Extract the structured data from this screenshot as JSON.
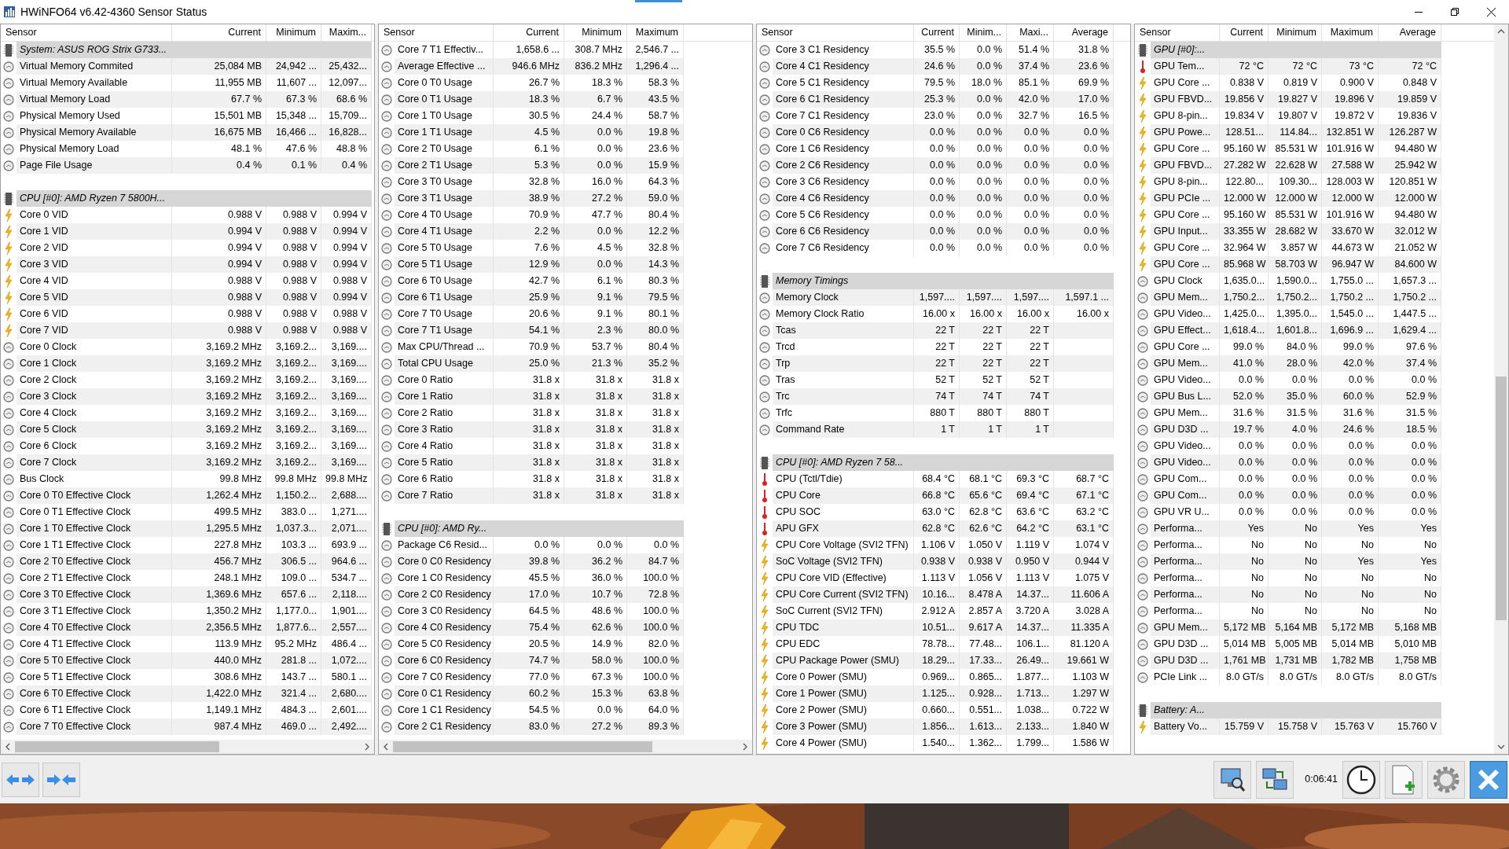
{
  "window": {
    "title": "HWiNFO64 v6.42-4360 Sensor Status"
  },
  "panels": [
    {
      "columns": [
        "Sensor",
        "Current",
        "Minimum",
        "Maxim..."
      ],
      "rows": [
        {
          "kind": "group",
          "label": "System: ASUS ROG Strix G733..."
        },
        {
          "kind": "clock",
          "label": "Virtual Memory Commited",
          "values": [
            "25,084 MB",
            "24,942 ...",
            "25,432..."
          ]
        },
        {
          "kind": "clock",
          "label": "Virtual Memory Available",
          "values": [
            "11,955 MB",
            "11,607 ...",
            "12,097..."
          ]
        },
        {
          "kind": "clock",
          "label": "Virtual Memory Load",
          "values": [
            "67.7 %",
            "67.3 %",
            "68.6 %"
          ]
        },
        {
          "kind": "clock",
          "label": "Physical Memory Used",
          "values": [
            "15,501 MB",
            "15,348 ...",
            "15,709..."
          ]
        },
        {
          "kind": "clock",
          "label": "Physical Memory Available",
          "values": [
            "16,675 MB",
            "16,466 ...",
            "16,828..."
          ]
        },
        {
          "kind": "clock",
          "label": "Physical Memory Load",
          "values": [
            "48.1 %",
            "47.6 %",
            "48.8 %"
          ]
        },
        {
          "kind": "clock",
          "label": "Page File Usage",
          "values": [
            "0.4 %",
            "0.1 %",
            "0.4 %"
          ]
        },
        {
          "kind": "blank"
        },
        {
          "kind": "group",
          "label": "CPU [#0]: AMD Ryzen 7 5800H..."
        },
        {
          "kind": "bolt",
          "label": "Core 0 VID",
          "values": [
            "0.988 V",
            "0.988 V",
            "0.994 V"
          ]
        },
        {
          "kind": "bolt",
          "label": "Core 1 VID",
          "values": [
            "0.994 V",
            "0.988 V",
            "0.994 V"
          ]
        },
        {
          "kind": "bolt",
          "label": "Core 2 VID",
          "values": [
            "0.994 V",
            "0.988 V",
            "0.994 V"
          ]
        },
        {
          "kind": "bolt",
          "label": "Core 3 VID",
          "values": [
            "0.994 V",
            "0.988 V",
            "0.994 V"
          ]
        },
        {
          "kind": "bolt",
          "label": "Core 4 VID",
          "values": [
            "0.988 V",
            "0.988 V",
            "0.988 V"
          ]
        },
        {
          "kind": "bolt",
          "label": "Core 5 VID",
          "values": [
            "0.988 V",
            "0.988 V",
            "0.994 V"
          ]
        },
        {
          "kind": "bolt",
          "label": "Core 6 VID",
          "values": [
            "0.988 V",
            "0.988 V",
            "0.988 V"
          ]
        },
        {
          "kind": "bolt",
          "label": "Core 7 VID",
          "values": [
            "0.988 V",
            "0.988 V",
            "0.988 V"
          ]
        },
        {
          "kind": "clock",
          "label": "Core 0 Clock",
          "values": [
            "3,169.2 MHz",
            "3,169.2...",
            "3,169...."
          ]
        },
        {
          "kind": "clock",
          "label": "Core 1 Clock",
          "values": [
            "3,169.2 MHz",
            "3,169.2...",
            "3,169...."
          ]
        },
        {
          "kind": "clock",
          "label": "Core 2 Clock",
          "values": [
            "3,169.2 MHz",
            "3,169.2...",
            "3,169...."
          ]
        },
        {
          "kind": "clock",
          "label": "Core 3 Clock",
          "values": [
            "3,169.2 MHz",
            "3,169.2...",
            "3,169...."
          ]
        },
        {
          "kind": "clock",
          "label": "Core 4 Clock",
          "values": [
            "3,169.2 MHz",
            "3,169.2...",
            "3,169...."
          ]
        },
        {
          "kind": "clock",
          "label": "Core 5 Clock",
          "values": [
            "3,169.2 MHz",
            "3,169.2...",
            "3,169...."
          ]
        },
        {
          "kind": "clock",
          "label": "Core 6 Clock",
          "values": [
            "3,169.2 MHz",
            "3,169.2...",
            "3,169...."
          ]
        },
        {
          "kind": "clock",
          "label": "Core 7 Clock",
          "values": [
            "3,169.2 MHz",
            "3,169.2...",
            "3,169...."
          ]
        },
        {
          "kind": "clock",
          "label": "Bus Clock",
          "values": [
            "99.8 MHz",
            "99.8 MHz",
            "99.8 MHz"
          ]
        },
        {
          "kind": "clock",
          "label": "Core 0 T0 Effective Clock",
          "values": [
            "1,262.4 MHz",
            "1,150.2...",
            "2,688...."
          ]
        },
        {
          "kind": "clock",
          "label": "Core 0 T1 Effective Clock",
          "values": [
            "499.5 MHz",
            "383.0 ...",
            "1,271...."
          ]
        },
        {
          "kind": "clock",
          "label": "Core 1 T0 Effective Clock",
          "values": [
            "1,295.5 MHz",
            "1,037.3...",
            "2,071...."
          ]
        },
        {
          "kind": "clock",
          "label": "Core 1 T1 Effective Clock",
          "values": [
            "227.8 MHz",
            "103.3 ...",
            "693.9 ..."
          ]
        },
        {
          "kind": "clock",
          "label": "Core 2 T0 Effective Clock",
          "values": [
            "456.7 MHz",
            "306.5 ...",
            "964.6 ..."
          ]
        },
        {
          "kind": "clock",
          "label": "Core 2 T1 Effective Clock",
          "values": [
            "248.1 MHz",
            "109.0 ...",
            "534.7 ..."
          ]
        },
        {
          "kind": "clock",
          "label": "Core 3 T0 Effective Clock",
          "values": [
            "1,369.6 MHz",
            "657.6 ...",
            "2,118...."
          ]
        },
        {
          "kind": "clock",
          "label": "Core 3 T1 Effective Clock",
          "values": [
            "1,350.2 MHz",
            "1,177.0...",
            "1,901...."
          ]
        },
        {
          "kind": "clock",
          "label": "Core 4 T0 Effective Clock",
          "values": [
            "2,356.5 MHz",
            "1,877.6...",
            "2,557...."
          ]
        },
        {
          "kind": "clock",
          "label": "Core 4 T1 Effective Clock",
          "values": [
            "113.9 MHz",
            "95.2 MHz",
            "486.4 ..."
          ]
        },
        {
          "kind": "clock",
          "label": "Core 5 T0 Effective Clock",
          "values": [
            "440.0 MHz",
            "281.8 ...",
            "1,072...."
          ]
        },
        {
          "kind": "clock",
          "label": "Core 5 T1 Effective Clock",
          "values": [
            "308.6 MHz",
            "143.7 ...",
            "580.1 ..."
          ]
        },
        {
          "kind": "clock",
          "label": "Core 6 T0 Effective Clock",
          "values": [
            "1,422.0 MHz",
            "321.4 ...",
            "2,680...."
          ]
        },
        {
          "kind": "clock",
          "label": "Core 6 T1 Effective Clock",
          "values": [
            "1,149.1 MHz",
            "484.3 ...",
            "2,601...."
          ]
        },
        {
          "kind": "clock",
          "label": "Core 7 T0 Effective Clock",
          "values": [
            "987.4 MHz",
            "469.0 ...",
            "2,492...."
          ]
        }
      ]
    },
    {
      "columns": [
        "Sensor",
        "Current",
        "Minimum",
        "Maximum"
      ],
      "rows": [
        {
          "kind": "clock",
          "label": "Core 7 T1 Effectiv...",
          "values": [
            "1,658.6 ...",
            "308.7 MHz",
            "2,546.7 ..."
          ]
        },
        {
          "kind": "clock",
          "label": "Average Effective ...",
          "values": [
            "946.6 MHz",
            "836.2 MHz",
            "1,296.4 ..."
          ]
        },
        {
          "kind": "clock",
          "label": "Core 0 T0 Usage",
          "values": [
            "26.7 %",
            "18.3 %",
            "58.3 %"
          ]
        },
        {
          "kind": "clock",
          "label": "Core 0 T1 Usage",
          "values": [
            "18.3 %",
            "6.7 %",
            "43.5 %"
          ]
        },
        {
          "kind": "clock",
          "label": "Core 1 T0 Usage",
          "values": [
            "30.5 %",
            "24.4 %",
            "58.7 %"
          ]
        },
        {
          "kind": "clock",
          "label": "Core 1 T1 Usage",
          "values": [
            "4.5 %",
            "0.0 %",
            "19.8 %"
          ]
        },
        {
          "kind": "clock",
          "label": "Core 2 T0 Usage",
          "values": [
            "6.1 %",
            "0.0 %",
            "23.6 %"
          ]
        },
        {
          "kind": "clock",
          "label": "Core 2 T1 Usage",
          "values": [
            "5.3 %",
            "0.0 %",
            "15.9 %"
          ]
        },
        {
          "kind": "clock",
          "label": "Core 3 T0 Usage",
          "values": [
            "32.8 %",
            "16.0 %",
            "64.3 %"
          ]
        },
        {
          "kind": "clock",
          "label": "Core 3 T1 Usage",
          "values": [
            "38.9 %",
            "27.2 %",
            "59.0 %"
          ]
        },
        {
          "kind": "clock",
          "label": "Core 4 T0 Usage",
          "values": [
            "70.9 %",
            "47.7 %",
            "80.4 %"
          ]
        },
        {
          "kind": "clock",
          "label": "Core 4 T1 Usage",
          "values": [
            "2.2 %",
            "0.0 %",
            "12.2 %"
          ]
        },
        {
          "kind": "clock",
          "label": "Core 5 T0 Usage",
          "values": [
            "7.6 %",
            "4.5 %",
            "32.8 %"
          ]
        },
        {
          "kind": "clock",
          "label": "Core 5 T1 Usage",
          "values": [
            "12.9 %",
            "0.0 %",
            "14.3 %"
          ]
        },
        {
          "kind": "clock",
          "label": "Core 6 T0 Usage",
          "values": [
            "42.7 %",
            "6.1 %",
            "80.3 %"
          ]
        },
        {
          "kind": "clock",
          "label": "Core 6 T1 Usage",
          "values": [
            "25.9 %",
            "9.1 %",
            "79.5 %"
          ]
        },
        {
          "kind": "clock",
          "label": "Core 7 T0 Usage",
          "values": [
            "20.6 %",
            "9.1 %",
            "80.1 %"
          ]
        },
        {
          "kind": "clock",
          "label": "Core 7 T1 Usage",
          "values": [
            "54.1 %",
            "2.3 %",
            "80.0 %"
          ]
        },
        {
          "kind": "clock",
          "label": "Max CPU/Thread ...",
          "values": [
            "70.9 %",
            "53.7 %",
            "80.4 %"
          ]
        },
        {
          "kind": "clock",
          "label": "Total CPU Usage",
          "values": [
            "25.0 %",
            "21.3 %",
            "35.2 %"
          ]
        },
        {
          "kind": "clock",
          "label": "Core 0 Ratio",
          "values": [
            "31.8 x",
            "31.8 x",
            "31.8 x"
          ]
        },
        {
          "kind": "clock",
          "label": "Core 1 Ratio",
          "values": [
            "31.8 x",
            "31.8 x",
            "31.8 x"
          ]
        },
        {
          "kind": "clock",
          "label": "Core 2 Ratio",
          "values": [
            "31.8 x",
            "31.8 x",
            "31.8 x"
          ]
        },
        {
          "kind": "clock",
          "label": "Core 3 Ratio",
          "values": [
            "31.8 x",
            "31.8 x",
            "31.8 x"
          ]
        },
        {
          "kind": "clock",
          "label": "Core 4 Ratio",
          "values": [
            "31.8 x",
            "31.8 x",
            "31.8 x"
          ]
        },
        {
          "kind": "clock",
          "label": "Core 5 Ratio",
          "values": [
            "31.8 x",
            "31.8 x",
            "31.8 x"
          ]
        },
        {
          "kind": "clock",
          "label": "Core 6 Ratio",
          "values": [
            "31.8 x",
            "31.8 x",
            "31.8 x"
          ]
        },
        {
          "kind": "clock",
          "label": "Core 7 Ratio",
          "values": [
            "31.8 x",
            "31.8 x",
            "31.8 x"
          ]
        },
        {
          "kind": "blank"
        },
        {
          "kind": "group",
          "label": "CPU [#0]: AMD Ry..."
        },
        {
          "kind": "clock",
          "label": "Package C6 Resid...",
          "values": [
            "0.0 %",
            "0.0 %",
            "0.0 %"
          ]
        },
        {
          "kind": "clock",
          "label": "Core 0 C0 Residency",
          "values": [
            "39.8 %",
            "36.2 %",
            "84.7 %"
          ]
        },
        {
          "kind": "clock",
          "label": "Core 1 C0 Residency",
          "values": [
            "45.5 %",
            "36.0 %",
            "100.0 %"
          ]
        },
        {
          "kind": "clock",
          "label": "Core 2 C0 Residency",
          "values": [
            "17.0 %",
            "10.7 %",
            "72.8 %"
          ]
        },
        {
          "kind": "clock",
          "label": "Core 3 C0 Residency",
          "values": [
            "64.5 %",
            "48.6 %",
            "100.0 %"
          ]
        },
        {
          "kind": "clock",
          "label": "Core 4 C0 Residency",
          "values": [
            "75.4 %",
            "62.6 %",
            "100.0 %"
          ]
        },
        {
          "kind": "clock",
          "label": "Core 5 C0 Residency",
          "values": [
            "20.5 %",
            "14.9 %",
            "82.0 %"
          ]
        },
        {
          "kind": "clock",
          "label": "Core 6 C0 Residency",
          "values": [
            "74.7 %",
            "58.0 %",
            "100.0 %"
          ]
        },
        {
          "kind": "clock",
          "label": "Core 7 C0 Residency",
          "values": [
            "77.0 %",
            "67.3 %",
            "100.0 %"
          ]
        },
        {
          "kind": "clock",
          "label": "Core 0 C1 Residency",
          "values": [
            "60.2 %",
            "15.3 %",
            "63.8 %"
          ]
        },
        {
          "kind": "clock",
          "label": "Core 1 C1 Residency",
          "values": [
            "54.5 %",
            "0.0 %",
            "64.0 %"
          ]
        },
        {
          "kind": "clock",
          "label": "Core 2 C1 Residency",
          "values": [
            "83.0 %",
            "27.2 %",
            "89.3 %"
          ]
        }
      ]
    },
    {
      "columns": [
        "Sensor",
        "Current",
        "Minim...",
        "Maxi...",
        "Average"
      ],
      "rows": [
        {
          "kind": "clock",
          "label": "Core 3 C1 Residency",
          "values": [
            "35.5 %",
            "0.0 %",
            "51.4 %",
            "31.8 %"
          ]
        },
        {
          "kind": "clock",
          "label": "Core 4 C1 Residency",
          "values": [
            "24.6 %",
            "0.0 %",
            "37.4 %",
            "23.6 %"
          ]
        },
        {
          "kind": "clock",
          "label": "Core 5 C1 Residency",
          "values": [
            "79.5 %",
            "18.0 %",
            "85.1 %",
            "69.9 %"
          ]
        },
        {
          "kind": "clock",
          "label": "Core 6 C1 Residency",
          "values": [
            "25.3 %",
            "0.0 %",
            "42.0 %",
            "17.0 %"
          ]
        },
        {
          "kind": "clock",
          "label": "Core 7 C1 Residency",
          "values": [
            "23.0 %",
            "0.0 %",
            "32.7 %",
            "16.5 %"
          ]
        },
        {
          "kind": "clock",
          "label": "Core 0 C6 Residency",
          "values": [
            "0.0 %",
            "0.0 %",
            "0.0 %",
            "0.0 %"
          ]
        },
        {
          "kind": "clock",
          "label": "Core 1 C6 Residency",
          "values": [
            "0.0 %",
            "0.0 %",
            "0.0 %",
            "0.0 %"
          ]
        },
        {
          "kind": "clock",
          "label": "Core 2 C6 Residency",
          "values": [
            "0.0 %",
            "0.0 %",
            "0.0 %",
            "0.0 %"
          ]
        },
        {
          "kind": "clock",
          "label": "Core 3 C6 Residency",
          "values": [
            "0.0 %",
            "0.0 %",
            "0.0 %",
            "0.0 %"
          ]
        },
        {
          "kind": "clock",
          "label": "Core 4 C6 Residency",
          "values": [
            "0.0 %",
            "0.0 %",
            "0.0 %",
            "0.0 %"
          ]
        },
        {
          "kind": "clock",
          "label": "Core 5 C6 Residency",
          "values": [
            "0.0 %",
            "0.0 %",
            "0.0 %",
            "0.0 %"
          ]
        },
        {
          "kind": "clock",
          "label": "Core 6 C6 Residency",
          "values": [
            "0.0 %",
            "0.0 %",
            "0.0 %",
            "0.0 %"
          ]
        },
        {
          "kind": "clock",
          "label": "Core 7 C6 Residency",
          "values": [
            "0.0 %",
            "0.0 %",
            "0.0 %",
            "0.0 %"
          ]
        },
        {
          "kind": "blank"
        },
        {
          "kind": "group",
          "label": "Memory Timings"
        },
        {
          "kind": "clock",
          "label": "Memory Clock",
          "values": [
            "1,597....",
            "1,597....",
            "1,597....",
            "1,597.1 ..."
          ]
        },
        {
          "kind": "clock",
          "label": "Memory Clock Ratio",
          "values": [
            "16.00 x",
            "16.00 x",
            "16.00 x",
            "16.00 x"
          ]
        },
        {
          "kind": "clock",
          "label": "Tcas",
          "values": [
            "22 T",
            "22 T",
            "22 T"
          ]
        },
        {
          "kind": "clock",
          "label": "Trcd",
          "values": [
            "22 T",
            "22 T",
            "22 T"
          ]
        },
        {
          "kind": "clock",
          "label": "Trp",
          "values": [
            "22 T",
            "22 T",
            "22 T"
          ]
        },
        {
          "kind": "clock",
          "label": "Tras",
          "values": [
            "52 T",
            "52 T",
            "52 T"
          ]
        },
        {
          "kind": "clock",
          "label": "Trc",
          "values": [
            "74 T",
            "74 T",
            "74 T"
          ]
        },
        {
          "kind": "clock",
          "label": "Trfc",
          "values": [
            "880 T",
            "880 T",
            "880 T"
          ]
        },
        {
          "kind": "clock",
          "label": "Command Rate",
          "values": [
            "1 T",
            "1 T",
            "1 T"
          ]
        },
        {
          "kind": "blank"
        },
        {
          "kind": "group",
          "label": "CPU [#0]: AMD Ryzen 7 58..."
        },
        {
          "kind": "thermo",
          "label": "CPU (Tctl/Tdie)",
          "values": [
            "68.4 °C",
            "68.1 °C",
            "69.3 °C",
            "68.7 °C"
          ]
        },
        {
          "kind": "thermo",
          "label": "CPU Core",
          "values": [
            "66.8 °C",
            "65.6 °C",
            "69.4 °C",
            "67.1 °C"
          ]
        },
        {
          "kind": "thermo",
          "label": "CPU SOC",
          "values": [
            "63.0 °C",
            "62.8 °C",
            "63.6 °C",
            "63.2 °C"
          ]
        },
        {
          "kind": "thermo",
          "label": "APU GFX",
          "values": [
            "62.8 °C",
            "62.6 °C",
            "64.2 °C",
            "63.1 °C"
          ]
        },
        {
          "kind": "bolt",
          "label": "CPU Core Voltage (SVI2 TFN)",
          "values": [
            "1.106 V",
            "1.050 V",
            "1.119 V",
            "1.074 V"
          ]
        },
        {
          "kind": "bolt",
          "label": "SoC Voltage (SVI2 TFN)",
          "values": [
            "0.938 V",
            "0.938 V",
            "0.950 V",
            "0.944 V"
          ]
        },
        {
          "kind": "bolt",
          "label": "CPU Core VID (Effective)",
          "values": [
            "1.113 V",
            "1.056 V",
            "1.113 V",
            "1.075 V"
          ]
        },
        {
          "kind": "bolt",
          "label": "CPU Core Current (SVI2 TFN)",
          "values": [
            "10.16...",
            "8.478 A",
            "14.37...",
            "11.606 A"
          ]
        },
        {
          "kind": "bolt",
          "label": "SoC Current (SVI2 TFN)",
          "values": [
            "2.912 A",
            "2.857 A",
            "3.720 A",
            "3.028 A"
          ]
        },
        {
          "kind": "bolt",
          "label": "CPU TDC",
          "values": [
            "10.51...",
            "9.617 A",
            "14.37...",
            "11.335 A"
          ]
        },
        {
          "kind": "bolt",
          "label": "CPU EDC",
          "values": [
            "78.78...",
            "77.48...",
            "106.1...",
            "81.120 A"
          ]
        },
        {
          "kind": "bolt",
          "label": "CPU Package Power (SMU)",
          "values": [
            "18.29...",
            "17.33...",
            "26.49...",
            "19.661 W"
          ]
        },
        {
          "kind": "bolt",
          "label": "Core 0 Power (SMU)",
          "values": [
            "0.969...",
            "0.865...",
            "1.877...",
            "1.103 W"
          ]
        },
        {
          "kind": "bolt",
          "label": "Core 1 Power (SMU)",
          "values": [
            "1.125...",
            "0.928...",
            "1.713...",
            "1.297 W"
          ]
        },
        {
          "kind": "bolt",
          "label": "Core 2 Power (SMU)",
          "values": [
            "0.660...",
            "0.551...",
            "1.038...",
            "0.722 W"
          ]
        },
        {
          "kind": "bolt",
          "label": "Core 3 Power (SMU)",
          "values": [
            "1.856...",
            "1.613...",
            "2.133...",
            "1.840 W"
          ]
        },
        {
          "kind": "bolt",
          "label": "Core 4 Power (SMU)",
          "values": [
            "1.540...",
            "1.362...",
            "1.799...",
            "1.586 W"
          ]
        }
      ]
    },
    {
      "columns": [
        "Sensor",
        "Current",
        "Minimum",
        "Maximum",
        "Average"
      ],
      "rows": [
        {
          "kind": "group",
          "label": "GPU [#0]:..."
        },
        {
          "kind": "thermo",
          "label": "GPU Tem...",
          "values": [
            "72 °C",
            "72 °C",
            "73 °C",
            "72 °C"
          ]
        },
        {
          "kind": "bolt",
          "label": "GPU Core ...",
          "values": [
            "0.838 V",
            "0.819 V",
            "0.900 V",
            "0.848 V"
          ]
        },
        {
          "kind": "bolt",
          "label": "GPU FBVD...",
          "values": [
            "19.856 V",
            "19.827 V",
            "19.896 V",
            "19.859 V"
          ]
        },
        {
          "kind": "bolt",
          "label": "GPU 8-pin...",
          "values": [
            "19.834 V",
            "19.807 V",
            "19.872 V",
            "19.836 V"
          ]
        },
        {
          "kind": "bolt",
          "label": "GPU Powe...",
          "values": [
            "128.51...",
            "114.84...",
            "132.851 W",
            "126.287 W"
          ]
        },
        {
          "kind": "bolt",
          "label": "GPU Core ...",
          "values": [
            "95.160 W",
            "85.531 W",
            "101.916 W",
            "94.480 W"
          ]
        },
        {
          "kind": "bolt",
          "label": "GPU FBVD...",
          "values": [
            "27.282 W",
            "22.628 W",
            "27.588 W",
            "25.942 W"
          ]
        },
        {
          "kind": "bolt",
          "label": "GPU 8-pin...",
          "values": [
            "122.80...",
            "109.30...",
            "128.003 W",
            "120.851 W"
          ]
        },
        {
          "kind": "bolt",
          "label": "GPU PCIe ...",
          "values": [
            "12.000 W",
            "12.000 W",
            "12.000 W",
            "12.000 W"
          ]
        },
        {
          "kind": "bolt",
          "label": "GPU Core ...",
          "values": [
            "95.160 W",
            "85.531 W",
            "101.916 W",
            "94.480 W"
          ]
        },
        {
          "kind": "bolt",
          "label": "GPU Input...",
          "values": [
            "33.355 W",
            "28.682 W",
            "33.670 W",
            "32.012 W"
          ]
        },
        {
          "kind": "bolt",
          "label": "GPU Core ...",
          "values": [
            "32.964 W",
            "3.857 W",
            "44.673 W",
            "21.052 W"
          ]
        },
        {
          "kind": "bolt",
          "label": "GPU Core ...",
          "values": [
            "85.968 W",
            "58.703 W",
            "96.947 W",
            "84.600 W"
          ]
        },
        {
          "kind": "clock",
          "label": "GPU Clock",
          "values": [
            "1,635.0...",
            "1,590.0...",
            "1,755.0 ...",
            "1,657.3 ..."
          ]
        },
        {
          "kind": "clock",
          "label": "GPU Mem...",
          "values": [
            "1,750.2...",
            "1,750.2...",
            "1,750.2 ...",
            "1,750.2 ..."
          ]
        },
        {
          "kind": "clock",
          "label": "GPU Video...",
          "values": [
            "1,425.0...",
            "1,395.0...",
            "1,545.0 ...",
            "1,447.5 ..."
          ]
        },
        {
          "kind": "clock",
          "label": "GPU Effect...",
          "values": [
            "1,618.4...",
            "1,601.8...",
            "1,696.9 ...",
            "1,629.4 ..."
          ]
        },
        {
          "kind": "clock",
          "label": "GPU Core ...",
          "values": [
            "99.0 %",
            "84.0 %",
            "99.0 %",
            "97.6 %"
          ]
        },
        {
          "kind": "clock",
          "label": "GPU Mem...",
          "values": [
            "41.0 %",
            "28.0 %",
            "42.0 %",
            "37.4 %"
          ]
        },
        {
          "kind": "clock",
          "label": "GPU Video...",
          "values": [
            "0.0 %",
            "0.0 %",
            "0.0 %",
            "0.0 %"
          ]
        },
        {
          "kind": "clock",
          "label": "GPU Bus L...",
          "values": [
            "52.0 %",
            "35.0 %",
            "60.0 %",
            "52.9 %"
          ]
        },
        {
          "kind": "clock",
          "label": "GPU Mem...",
          "values": [
            "31.6 %",
            "31.5 %",
            "31.6 %",
            "31.5 %"
          ]
        },
        {
          "kind": "clock",
          "label": "GPU D3D ...",
          "values": [
            "19.7 %",
            "4.0 %",
            "24.6 %",
            "18.5 %"
          ]
        },
        {
          "kind": "clock",
          "label": "GPU Video...",
          "values": [
            "0.0 %",
            "0.0 %",
            "0.0 %",
            "0.0 %"
          ]
        },
        {
          "kind": "clock",
          "label": "GPU Video...",
          "values": [
            "0.0 %",
            "0.0 %",
            "0.0 %",
            "0.0 %"
          ]
        },
        {
          "kind": "clock",
          "label": "GPU Com...",
          "values": [
            "0.0 %",
            "0.0 %",
            "0.0 %",
            "0.0 %"
          ]
        },
        {
          "kind": "clock",
          "label": "GPU Com...",
          "values": [
            "0.0 %",
            "0.0 %",
            "0.0 %",
            "0.0 %"
          ]
        },
        {
          "kind": "clock",
          "label": "GPU VR U...",
          "values": [
            "0.0 %",
            "0.0 %",
            "0.0 %",
            "0.0 %"
          ]
        },
        {
          "kind": "clock",
          "label": "Performa...",
          "values": [
            "Yes",
            "No",
            "Yes",
            "Yes"
          ]
        },
        {
          "kind": "clock",
          "label": "Performa...",
          "values": [
            "No",
            "No",
            "No",
            "No"
          ]
        },
        {
          "kind": "clock",
          "label": "Performa...",
          "values": [
            "No",
            "No",
            "Yes",
            "Yes"
          ]
        },
        {
          "kind": "clock",
          "label": "Performa...",
          "values": [
            "No",
            "No",
            "No",
            "No"
          ]
        },
        {
          "kind": "clock",
          "label": "Performa...",
          "values": [
            "No",
            "No",
            "No",
            "No"
          ]
        },
        {
          "kind": "clock",
          "label": "Performa...",
          "values": [
            "No",
            "No",
            "No",
            "No"
          ]
        },
        {
          "kind": "clock",
          "label": "GPU Mem...",
          "values": [
            "5,172 MB",
            "5,164 MB",
            "5,172 MB",
            "5,168 MB"
          ]
        },
        {
          "kind": "clock",
          "label": "GPU D3D ...",
          "values": [
            "5,014 MB",
            "5,005 MB",
            "5,014 MB",
            "5,010 MB"
          ]
        },
        {
          "kind": "clock",
          "label": "GPU D3D ...",
          "values": [
            "1,761 MB",
            "1,731 MB",
            "1,782 MB",
            "1,758 MB"
          ]
        },
        {
          "kind": "clock",
          "label": "PCIe Link ...",
          "values": [
            "8.0 GT/s",
            "8.0 GT/s",
            "8.0 GT/s",
            "8.0 GT/s"
          ]
        },
        {
          "kind": "blank"
        },
        {
          "kind": "group",
          "label": "Battery: A..."
        },
        {
          "kind": "bolt",
          "label": "Battery Vo...",
          "values": [
            "15.759 V",
            "15.758 V",
            "15.763 V",
            "15.760 V"
          ]
        }
      ]
    }
  ],
  "toolbar": {
    "elapsed": "0:06:41"
  }
}
